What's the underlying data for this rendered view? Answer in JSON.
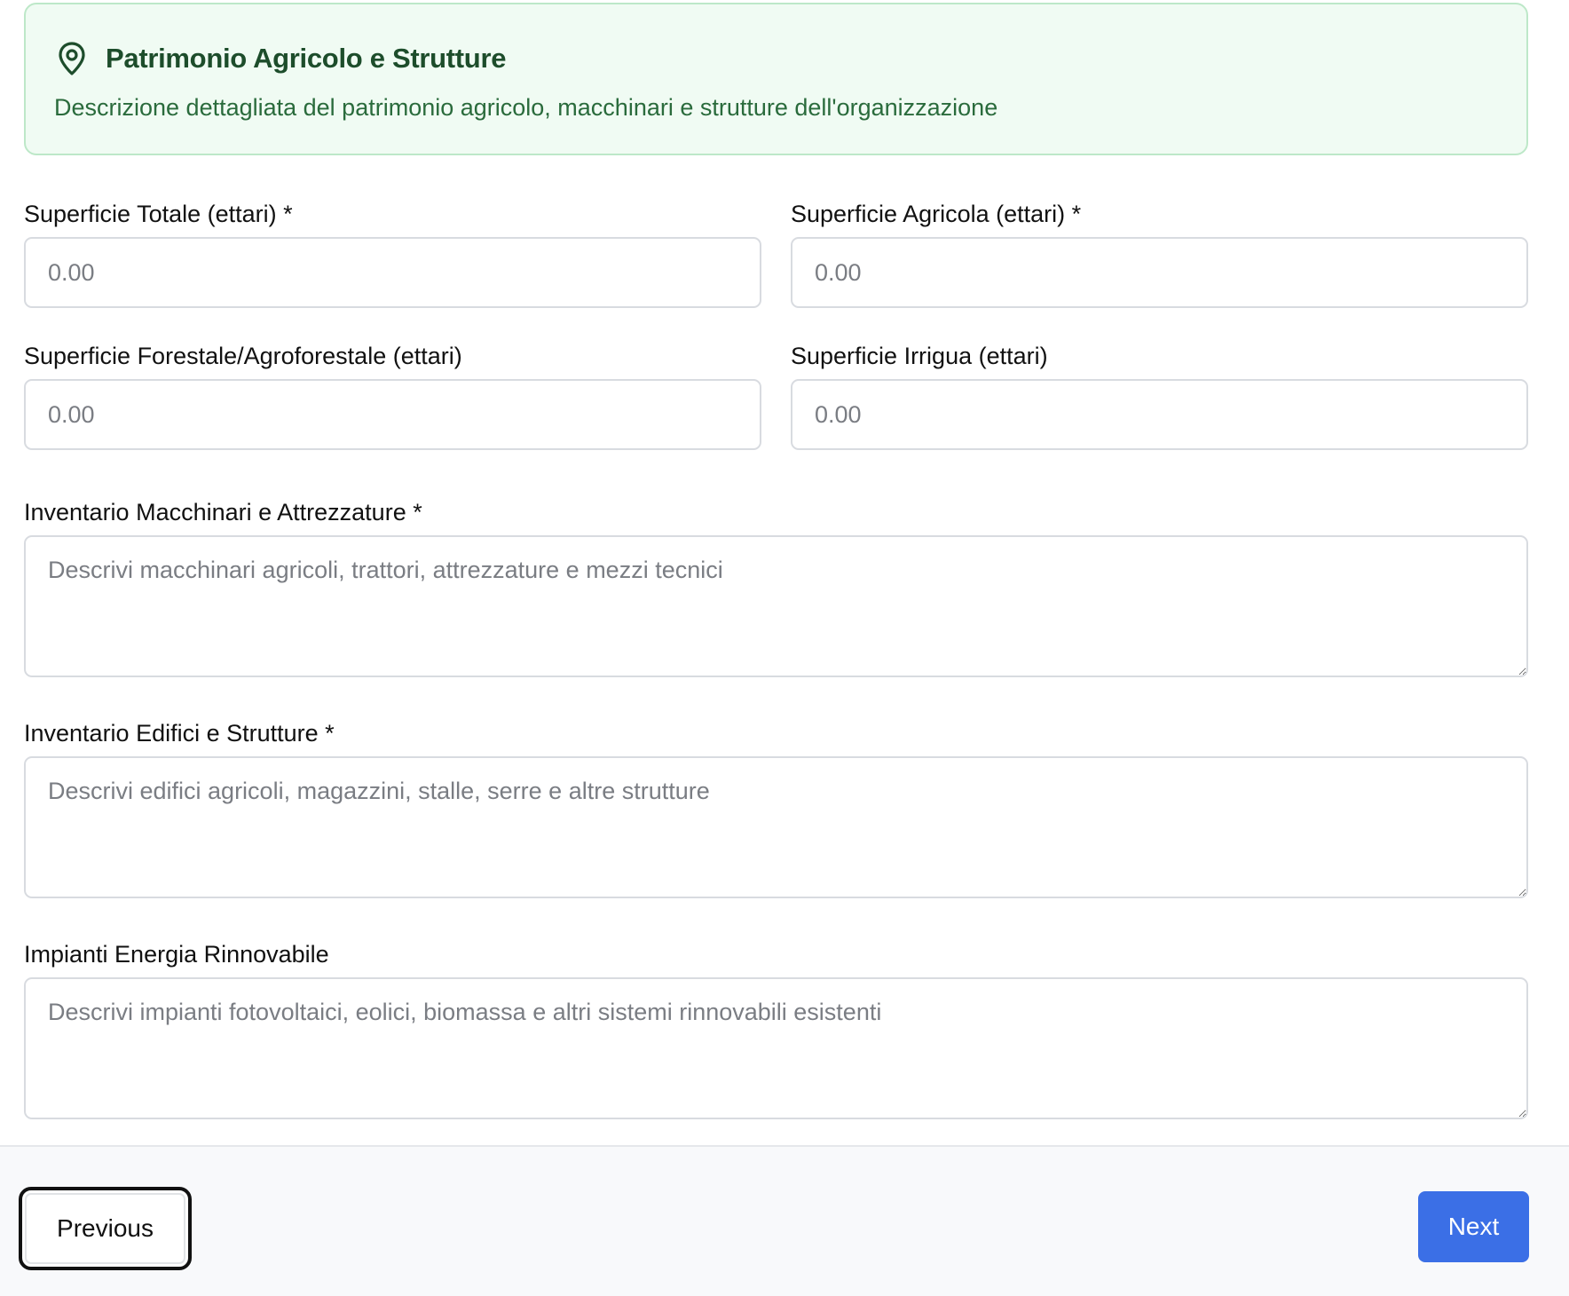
{
  "section": {
    "title": "Patrimonio Agricolo e Strutture",
    "description": "Descrizione dettagliata del patrimonio agricolo, macchinari e strutture dell'organizzazione",
    "icon": "map-pin-icon",
    "accent_color": "#1d4d2b",
    "banner_background": "#f0fbf3"
  },
  "fields": {
    "superficie_totale": {
      "label": "Superficie Totale (ettari) *",
      "placeholder": "0.00",
      "value": ""
    },
    "superficie_agricola": {
      "label": "Superficie Agricola (ettari) *",
      "placeholder": "0.00",
      "value": ""
    },
    "superficie_forestale": {
      "label": "Superficie Forestale/Agroforestale (ettari)",
      "placeholder": "0.00",
      "value": ""
    },
    "superficie_irrigua": {
      "label": "Superficie Irrigua (ettari)",
      "placeholder": "0.00",
      "value": ""
    },
    "inventario_macchinari": {
      "label": "Inventario Macchinari e Attrezzature *",
      "placeholder": "Descrivi macchinari agricoli, trattori, attrezzature e mezzi tecnici",
      "value": ""
    },
    "inventario_edifici": {
      "label": "Inventario Edifici e Strutture *",
      "placeholder": "Descrivi edifici agricoli, magazzini, stalle, serre e altre strutture",
      "value": ""
    },
    "impianti_energia": {
      "label": "Impianti Energia Rinnovabile",
      "placeholder": "Descrivi impianti fotovoltaici, eolici, biomassa e altri sistemi rinnovabili esistenti",
      "value": ""
    }
  },
  "navigation": {
    "previous_label": "Previous",
    "next_label": "Next",
    "next_color": "#3b6fe6"
  }
}
